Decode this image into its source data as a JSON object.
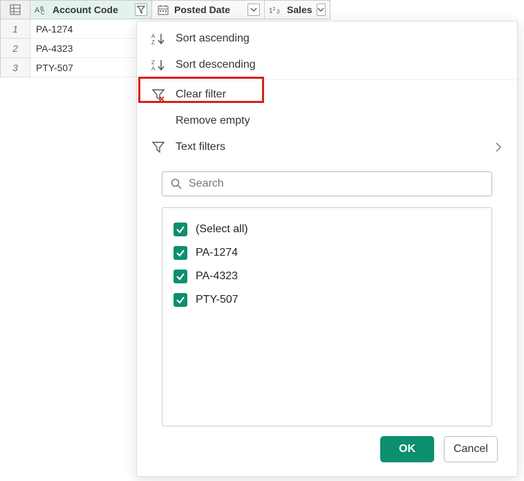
{
  "columns": {
    "account": "Account Code",
    "posted": "Posted Date",
    "sales": "Sales"
  },
  "rows": [
    {
      "num": "1",
      "account": "PA-1274"
    },
    {
      "num": "2",
      "account": "PA-4323"
    },
    {
      "num": "3",
      "account": "PTY-507"
    }
  ],
  "menu": {
    "sort_asc": "Sort ascending",
    "sort_desc": "Sort descending",
    "clear_filter": "Clear filter",
    "remove_empty": "Remove empty",
    "text_filters": "Text filters"
  },
  "search": {
    "placeholder": "Search"
  },
  "checklist": {
    "select_all": "(Select all)",
    "items": [
      "PA-1274",
      "PA-4323",
      "PTY-507"
    ]
  },
  "footer": {
    "ok": "OK",
    "cancel": "Cancel"
  }
}
